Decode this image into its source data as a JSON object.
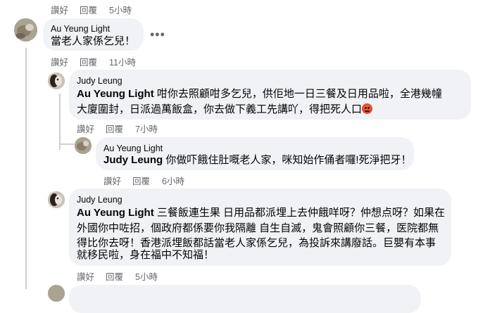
{
  "top_actions": {
    "like": "讚好",
    "reply": "回覆",
    "time": "5小時"
  },
  "comments": [
    {
      "author": "Au Yeung Light",
      "text": "當老人家係乞兒！",
      "actions": {
        "like": "讚好",
        "reply": "回覆",
        "time": "11小時"
      },
      "more_icon": "more-horizontal-icon"
    },
    {
      "author": "Judy Leung",
      "mention": "Au Yeung Light",
      "line1": " 咁你去照顧咁多乞兒，供佢地一日三餐及日用品啦，全港幾幢",
      "line2": "大廈圍封，日派過萬飯盒，你去做下義工先講吖，得把死人口",
      "emoji": "angry-face-emoji",
      "actions": {
        "like": "讚好",
        "reply": "回覆",
        "time": "7小時"
      }
    },
    {
      "author": "Au Yeung Light",
      "mention": "Judy Leung",
      "line1": " 你做吓餓住肚嘅老人家，咪知始作俑者囉!死淨把牙！",
      "actions": {
        "like": "讚好",
        "reply": "回覆",
        "time": "6小時"
      }
    },
    {
      "author": "Judy Leung",
      "mention": "Au Yeung Light",
      "line1": " 三餐飯連生果 日用品都派埋上去仲餓咩呀？仲想点呀？如果在",
      "line2": "外國你中咗招，個政府都係要你我隔離 自生自滅，鬼會照顧你三餐，医院都無",
      "line3": "得比你去呀！香港派埋飯都話當老人家係乞兒，為投訴來講廢話。巨嬰有本事",
      "line4": "就移民啦，身在福中不知福！",
      "actions": {
        "like": "讚好",
        "reply": "回覆",
        "time": "5小時"
      }
    }
  ]
}
